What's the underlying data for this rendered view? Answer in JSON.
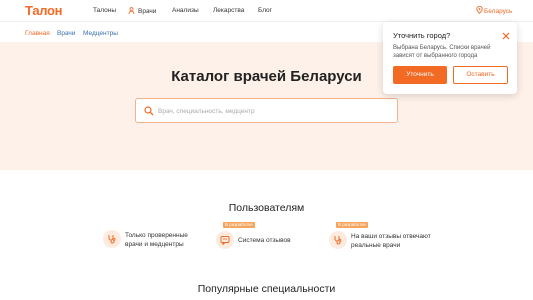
{
  "header": {
    "logo": "Талон",
    "nav": [
      {
        "label": "Талоны"
      },
      {
        "label": "Врачи"
      },
      {
        "label": "Анализы"
      },
      {
        "label": "Лекарства"
      },
      {
        "label": "Блог"
      }
    ],
    "city": "Беларусь"
  },
  "breadcrumbs": [
    "Главная",
    "Врачи",
    "Медцентры"
  ],
  "hero": {
    "title": "Каталог врачей Беларуси",
    "search_placeholder": "Врач, специальность, медцентр"
  },
  "city_popup": {
    "title": "Уточнить город?",
    "text": "Выбрана Беларусь. Списки врачей зависят от выбранного города",
    "confirm_label": "Уточнить",
    "keep_label": "Оставить"
  },
  "users_section": {
    "title": "Пользователям",
    "features": [
      {
        "text_line1": "Только проверенные",
        "text_line2": "врачи и медцентры",
        "badge": ""
      },
      {
        "text_line1": "Система отзывов",
        "text_line2": "",
        "badge": "В разработке"
      },
      {
        "text_line1": "На ваши отзывы отвечают",
        "text_line2": "реальные врачи",
        "badge": "В разработке"
      }
    ]
  },
  "popular_section": {
    "title": "Популярные специальности"
  },
  "colors": {
    "accent": "#f26a24",
    "hero_bg": "#fdf1e9",
    "link": "#3a6fb0"
  }
}
